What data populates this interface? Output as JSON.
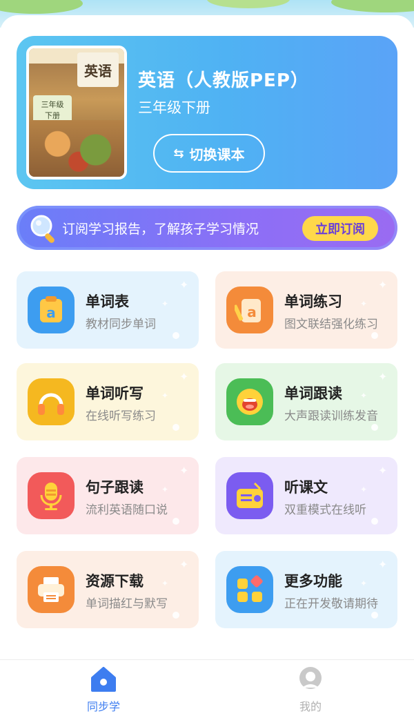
{
  "book": {
    "title": "英语（人教版PEP）",
    "grade": "三年级下册",
    "switch_label": "切换课本",
    "cover_title": "英语",
    "cover_grade_line1": "三年级",
    "cover_grade_line2": "下册"
  },
  "subscribe": {
    "text": "订阅学习报告，了解孩子学习情况",
    "button": "立即订阅"
  },
  "features": [
    {
      "title": "单词表",
      "subtitle": "教材同步单词",
      "icon": "vocabulary-book-icon",
      "bg": "#e4f3fd",
      "icon_bg": "#3d9df0"
    },
    {
      "title": "单词练习",
      "subtitle": "图文联结强化练习",
      "icon": "word-practice-icon",
      "bg": "#fdeee5",
      "icon_bg": "#f48b3a"
    },
    {
      "title": "单词听写",
      "subtitle": "在线听写练习",
      "icon": "headphones-icon",
      "bg": "#fdf6dc",
      "icon_bg": "#f5b820"
    },
    {
      "title": "单词跟读",
      "subtitle": "大声跟读训练发音",
      "icon": "speaking-face-icon",
      "bg": "#e6f7e6",
      "icon_bg": "#4bbd56"
    },
    {
      "title": "句子跟读",
      "subtitle": "流利英语随口说",
      "icon": "microphone-icon",
      "bg": "#fde8ea",
      "icon_bg": "#f25a5a"
    },
    {
      "title": "听课文",
      "subtitle": "双重模式在线听",
      "icon": "radio-icon",
      "bg": "#efe9fd",
      "icon_bg": "#7b5cf0"
    },
    {
      "title": "资源下载",
      "subtitle": "单词描红与默写",
      "icon": "printer-icon",
      "bg": "#fdeee5",
      "icon_bg": "#f48b3a"
    },
    {
      "title": "更多功能",
      "subtitle": "正在开发敬请期待",
      "icon": "grid-apps-icon",
      "bg": "#e4f3fd",
      "icon_bg": "#3d9df0"
    }
  ],
  "nav": {
    "items": [
      {
        "label": "同步学",
        "active": true,
        "color": "#3d7df0"
      },
      {
        "label": "我的",
        "active": false,
        "color": "#b0b0b0"
      }
    ]
  }
}
